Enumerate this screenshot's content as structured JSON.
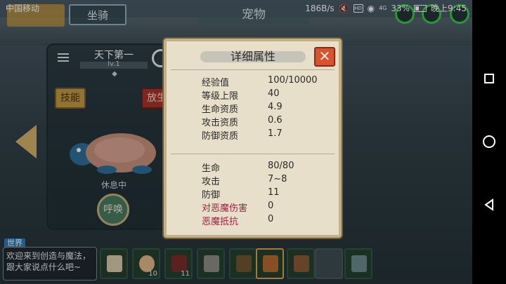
{
  "status_bar": {
    "carrier": "中国移动",
    "net_speed": "186B/s",
    "hd_badge": "HD",
    "signal_label": "4G",
    "battery": "33%",
    "time": "晚上9:45"
  },
  "top_bar": {
    "tab_mount": "坐骑",
    "title": "宠物",
    "close_glyph": "✕"
  },
  "pet": {
    "name": "天下第一",
    "level": "lv.1",
    "skill_button": "技能",
    "release_button": "放生",
    "status": "休息中",
    "summon_button": "呼唤",
    "level_progress": 0.01
  },
  "dialog": {
    "title": "详细属性",
    "close_glyph": "✕",
    "attributes_growth": [
      {
        "key": "经验值",
        "value": "100/10000"
      },
      {
        "key": "等级上限",
        "value": "40"
      },
      {
        "key": "生命资质",
        "value": "4.9"
      },
      {
        "key": "攻击资质",
        "value": "0.6"
      },
      {
        "key": "防御资质",
        "value": "1.7"
      }
    ],
    "attributes_combat": [
      {
        "key": "生命",
        "value": "80/80"
      },
      {
        "key": "攻击",
        "value": "7~8"
      },
      {
        "key": "防御",
        "value": "11"
      },
      {
        "key": "对恶魔伤害",
        "value": "0"
      },
      {
        "key": "恶魔抵抗",
        "value": "0"
      }
    ]
  },
  "chat": {
    "channel": "世界",
    "message": "欢迎来到创造与魔法，跟大家说点什么吧~"
  },
  "bag_slots": [
    {
      "item": "feather-icon",
      "count": ""
    },
    {
      "item": "soup-bowl-icon",
      "count": "10"
    },
    {
      "item": "cake-icon",
      "count": "11"
    },
    {
      "item": "axe-icon",
      "count": ""
    },
    {
      "item": "bow-icon",
      "count": ""
    },
    {
      "item": "meat-icon",
      "count": ""
    },
    {
      "item": "torch-icon",
      "count": ""
    },
    {
      "item": "empty-slot",
      "count": ""
    },
    {
      "item": "spear-icon",
      "count": ""
    }
  ],
  "colors": {
    "dialog_bg": "#e8dfcb",
    "close_red": "#d9532f",
    "demon_red": "#9b2040",
    "ring_green": "#3bc94a"
  }
}
